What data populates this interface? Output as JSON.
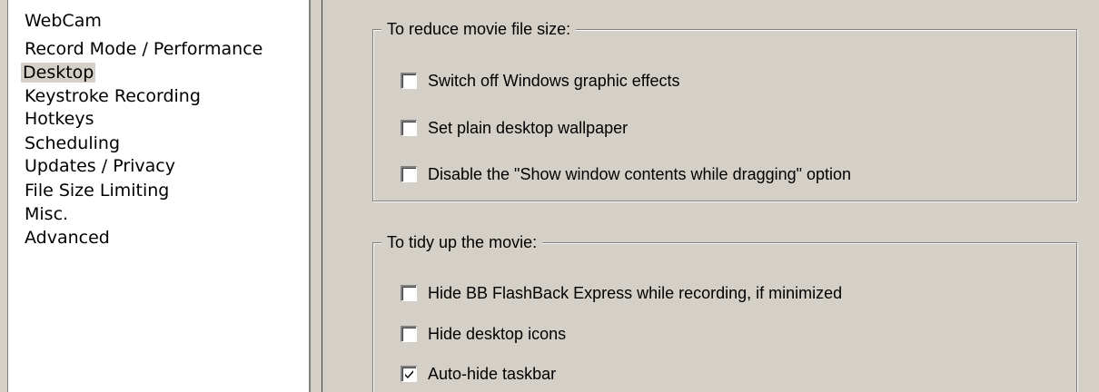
{
  "sidebar": {
    "items": [
      {
        "label": "WebCam",
        "selected": false
      },
      {
        "label": "Record Mode / Performance",
        "selected": false
      },
      {
        "label": "Desktop",
        "selected": true
      },
      {
        "label": "Keystroke Recording",
        "selected": false
      },
      {
        "label": "Hotkeys",
        "selected": false
      },
      {
        "label": "Scheduling",
        "selected": false
      },
      {
        "label": "Updates / Privacy",
        "selected": false
      },
      {
        "label": "File Size Limiting",
        "selected": false
      },
      {
        "label": "Misc.",
        "selected": false
      },
      {
        "label": "Advanced",
        "selected": false
      }
    ]
  },
  "groups": {
    "reduce": {
      "title": "To reduce movie file size:",
      "options": [
        {
          "label": "Switch off Windows graphic effects",
          "checked": false
        },
        {
          "label": "Set plain desktop wallpaper",
          "checked": false
        },
        {
          "label": "Disable the \"Show window contents while dragging\" option",
          "checked": false
        }
      ]
    },
    "tidy": {
      "title": "To tidy up the movie:",
      "options": [
        {
          "label": "Hide BB FlashBack Express while recording, if minimized",
          "checked": false
        },
        {
          "label": "Hide desktop icons",
          "checked": false
        },
        {
          "label": "Auto-hide taskbar",
          "checked": true
        }
      ]
    }
  },
  "colors": {
    "panel_bg": "#d4d0c8",
    "selection_bg": "#d4d0c8",
    "text": "#000000"
  }
}
